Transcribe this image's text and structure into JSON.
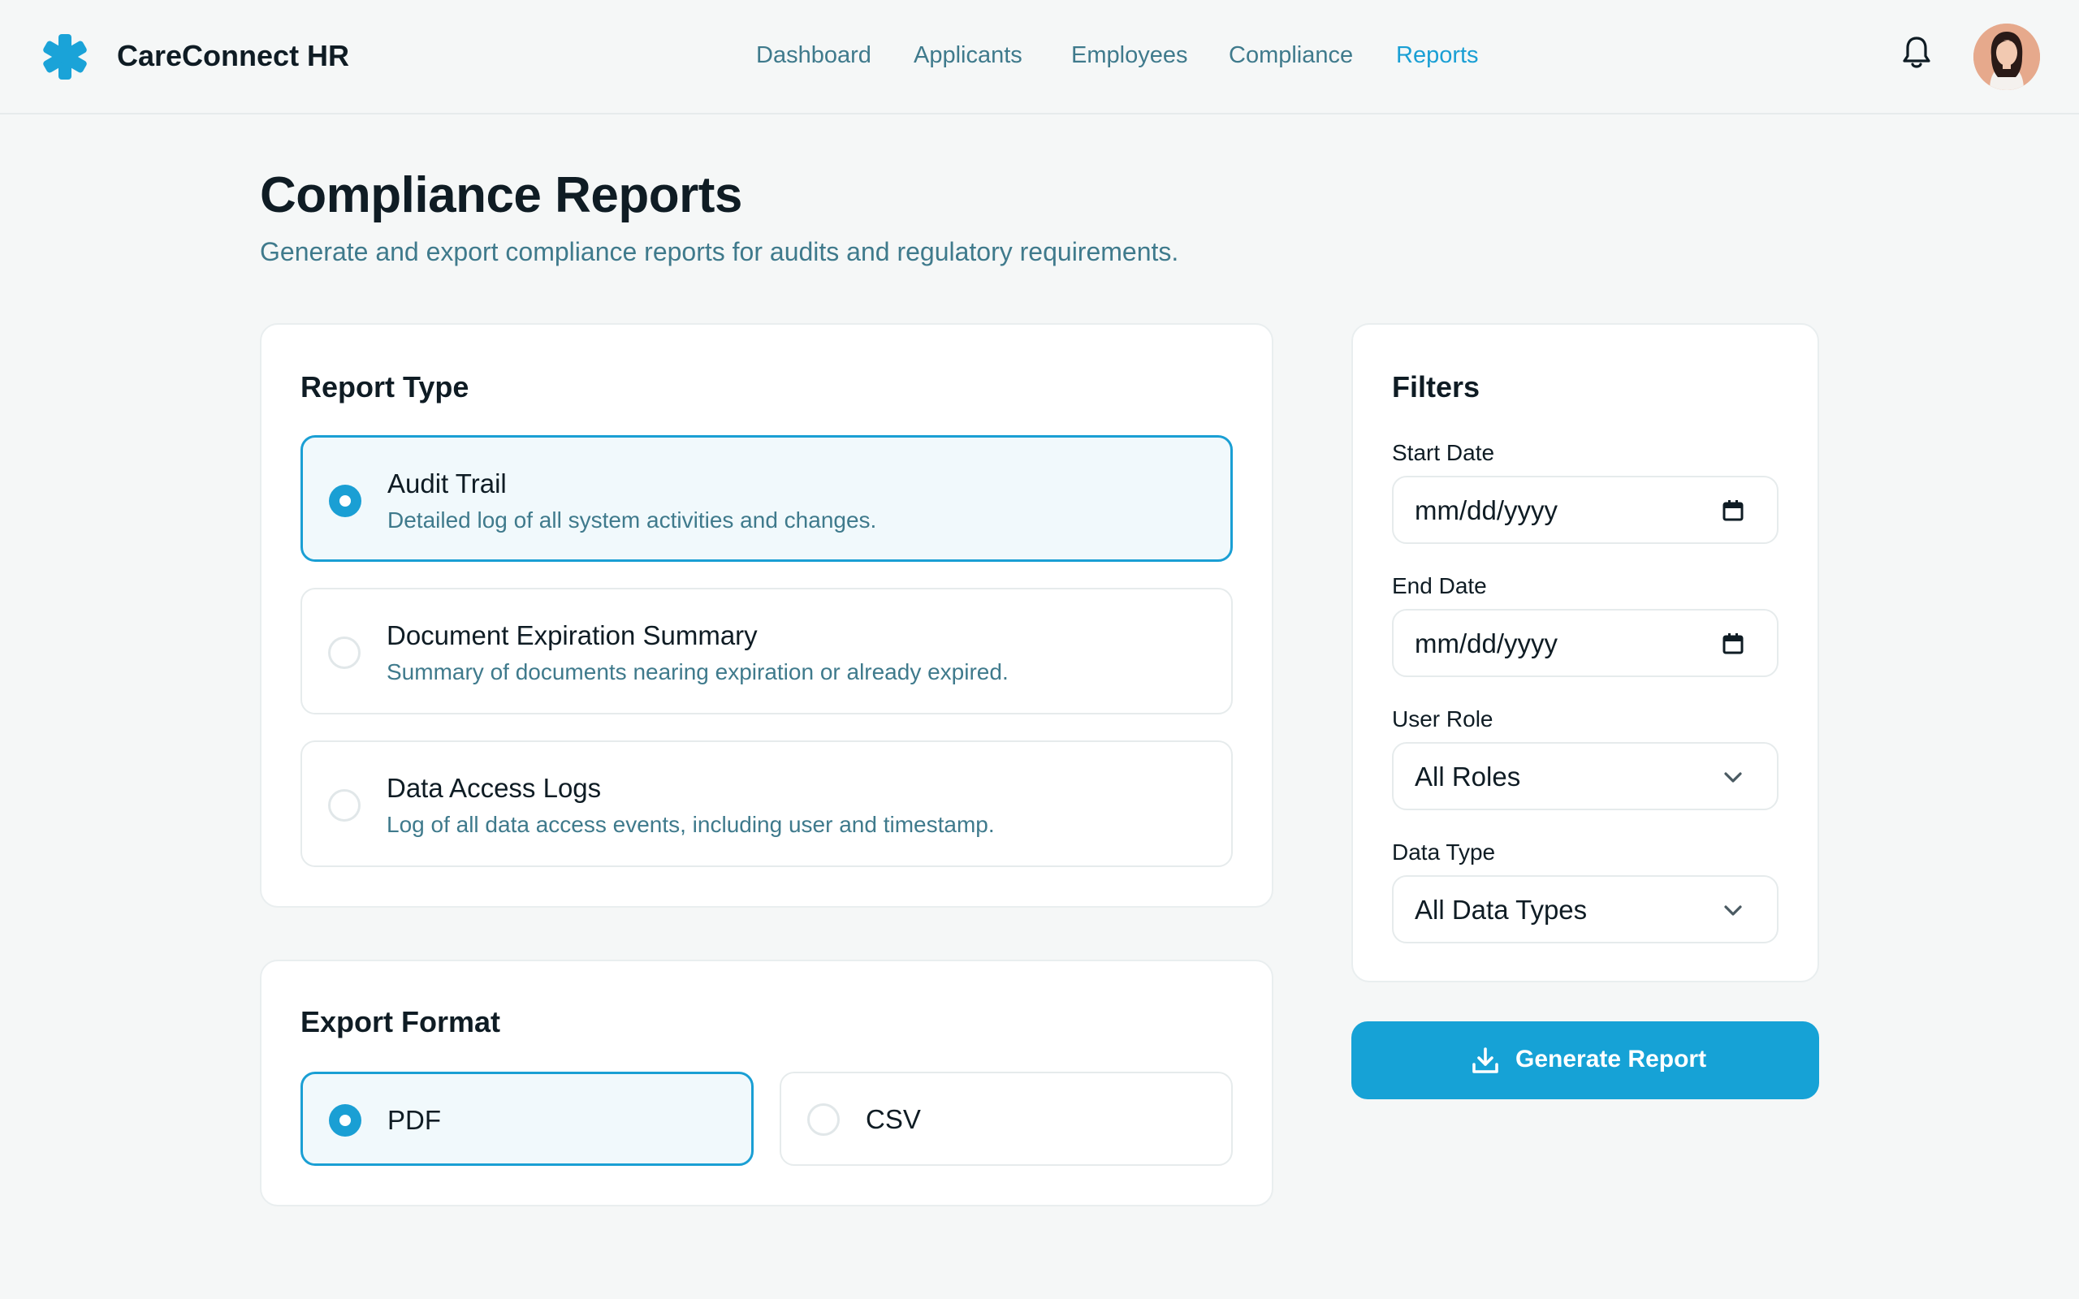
{
  "app": {
    "brand": "CareConnect HR"
  },
  "nav": [
    {
      "label": "Dashboard",
      "active": false
    },
    {
      "label": "Applicants",
      "active": false
    },
    {
      "label": "Employees",
      "active": false
    },
    {
      "label": "Compliance",
      "active": false
    },
    {
      "label": "Reports",
      "active": true
    }
  ],
  "header_icons": {
    "notifications": "bell-icon",
    "profile": "avatar"
  },
  "page": {
    "title": "Compliance Reports",
    "subtitle": "Generate and export compliance reports for audits and regulatory requirements."
  },
  "report_type": {
    "heading": "Report Type",
    "options": [
      {
        "title": "Audit Trail",
        "description": "Detailed log of all system activities and changes.",
        "selected": true
      },
      {
        "title": "Document Expiration Summary",
        "description": "Summary of documents nearing expiration or already expired.",
        "selected": false
      },
      {
        "title": "Data Access Logs",
        "description": "Log of all data access events, including user and timestamp.",
        "selected": false
      }
    ]
  },
  "export_format": {
    "heading": "Export Format",
    "options": [
      {
        "label": "PDF",
        "selected": true
      },
      {
        "label": "CSV",
        "selected": false
      }
    ]
  },
  "filters": {
    "heading": "Filters",
    "start_date": {
      "label": "Start Date",
      "placeholder": "mm/dd/yyyy",
      "icon": "calendar-icon"
    },
    "end_date": {
      "label": "End Date",
      "placeholder": "mm/dd/yyyy",
      "icon": "calendar-icon"
    },
    "user_role": {
      "label": "User Role",
      "value": "All Roles",
      "icon": "chevron-down-icon"
    },
    "data_type": {
      "label": "Data Type",
      "value": "All Data Types",
      "icon": "chevron-down-icon"
    }
  },
  "actions": {
    "generate_label": "Generate Report",
    "generate_icon": "download-icon"
  },
  "colors": {
    "accent": "#16a2d6",
    "muted_text": "#3f7a8c",
    "background": "#f5f7f7",
    "card": "#ffffff",
    "selected_bg": "#f1f9fc"
  }
}
